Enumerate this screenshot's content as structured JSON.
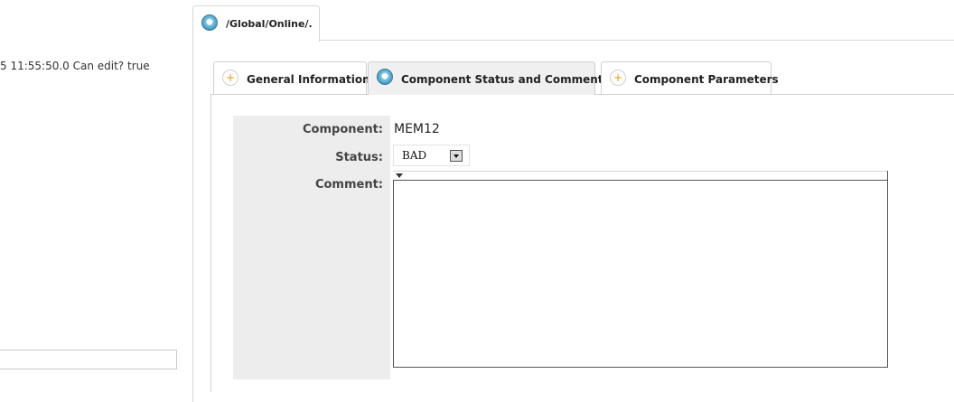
{
  "left": {
    "info_text": "5 11:55:50.0 Can edit? true",
    "input_value": ""
  },
  "outer_tab": {
    "label": "/Global/Online/.",
    "icon": "expand-arrow-icon"
  },
  "inner_tabs": [
    {
      "label": "General Information",
      "icon": "plus-icon",
      "active": false
    },
    {
      "label": "Component Status and Comments",
      "icon": "expand-arrow-icon",
      "active": true
    },
    {
      "label": "Component Parameters",
      "icon": "plus-icon",
      "active": false
    }
  ],
  "form": {
    "component_label": "Component:",
    "component_value": "MEM12",
    "status_label": "Status:",
    "status_value": "BAD",
    "comment_label": "Comment:",
    "comment_value": ""
  },
  "colors": {
    "accent": "#4a9fc4",
    "plus": "#e09a1a",
    "form_bg": "#ededed"
  }
}
